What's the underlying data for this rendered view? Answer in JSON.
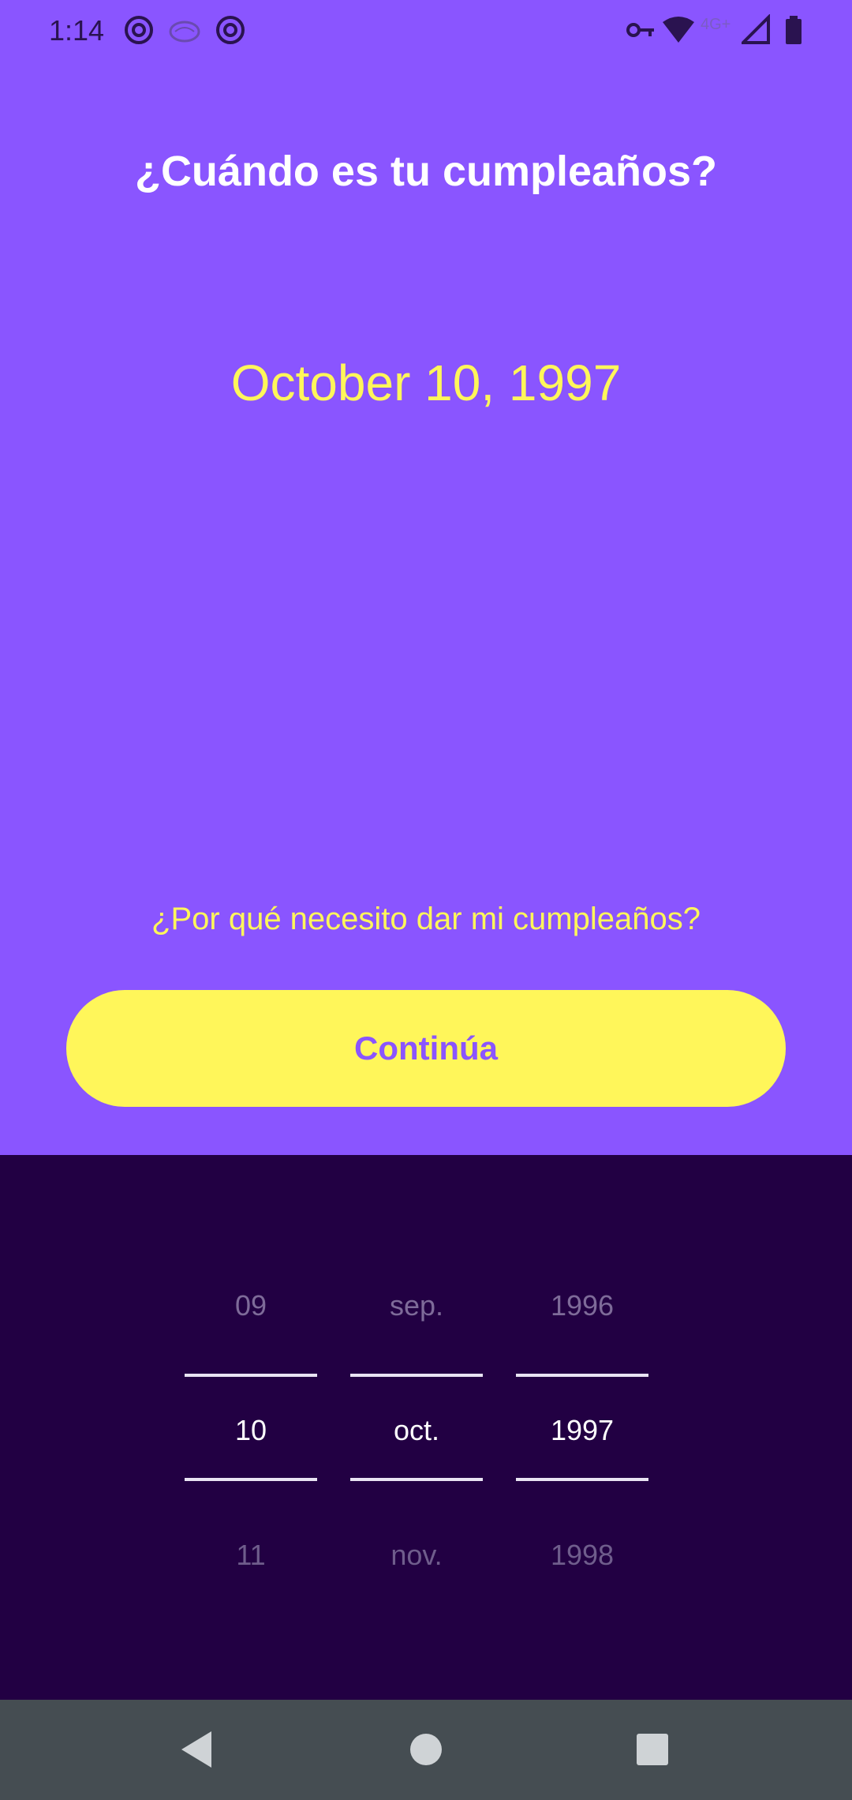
{
  "status_bar": {
    "time": "1:14",
    "icons": [
      "at-sign-icon",
      "brain-icon",
      "at-sign-icon",
      "key-icon",
      "wifi-icon",
      "signal-4g-icon",
      "battery-icon"
    ],
    "network": "4G+"
  },
  "header": {
    "title": "¿Cuándo es tu cumpleaños?"
  },
  "selected_date": "October 10, 1997",
  "why_link": "¿Por qué necesito dar mi cumpleaños?",
  "continue_button": {
    "label": "Continúa"
  },
  "picker": {
    "day": {
      "prev": "09",
      "selected": "10",
      "next": "11"
    },
    "month": {
      "prev": "sep.",
      "selected": "oct.",
      "next": "nov."
    },
    "year": {
      "prev": "1996",
      "selected": "1997",
      "next": "1998"
    }
  },
  "nav": {
    "icons": [
      "back-icon",
      "home-icon",
      "recents-icon"
    ]
  },
  "colors": {
    "primary": "#8a55ff",
    "accent": "#fff65a",
    "picker_bg": "#220043",
    "nav_bg": "#454d52"
  }
}
